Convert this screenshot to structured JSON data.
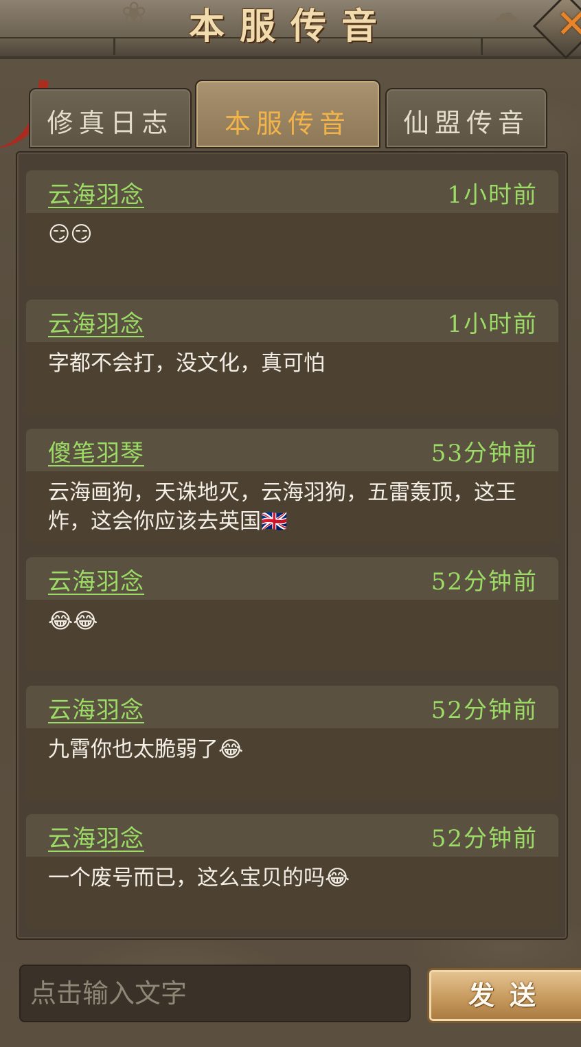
{
  "header": {
    "title": "本服传音",
    "close_icon": "close-icon"
  },
  "tabs": [
    {
      "label": "修真日志",
      "active": false
    },
    {
      "label": "本服传音",
      "active": true
    },
    {
      "label": "仙盟传音",
      "active": false
    }
  ],
  "messages": [
    {
      "name": "云海羽念",
      "time": "1小时前",
      "text": "😏😏"
    },
    {
      "name": "云海羽念",
      "time": "1小时前",
      "text": "字都不会打，没文化，真可怕"
    },
    {
      "name": "傻笔羽琴",
      "time": "53分钟前",
      "text": "云海画狗，天诛地灭，云海羽狗，五雷轰顶，这王炸，这会你应该去英国🇬🇧"
    },
    {
      "name": "云海羽念",
      "time": "52分钟前",
      "text": "😂😂"
    },
    {
      "name": "云海羽念",
      "time": "52分钟前",
      "text": "九霄你也太脆弱了😂"
    },
    {
      "name": "云海羽念",
      "time": "52分钟前",
      "text": "一个废号而已，这么宝贝的吗😂"
    }
  ],
  "input": {
    "placeholder": "点击输入文字",
    "value": ""
  },
  "send_button": {
    "label": "发送"
  },
  "colors": {
    "name_green": "#9bdb66",
    "tab_active_text": "#f2b44a",
    "close_orange": "#e8852a"
  }
}
